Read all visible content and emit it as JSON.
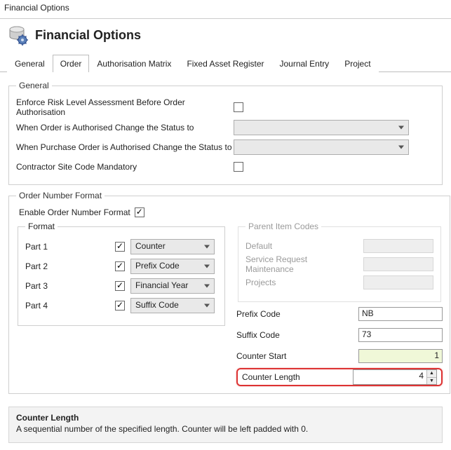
{
  "window": {
    "title": "Financial Options"
  },
  "header": {
    "title": "Financial Options"
  },
  "tabs": {
    "items": [
      {
        "label": "General"
      },
      {
        "label": "Order"
      },
      {
        "label": "Authorisation Matrix"
      },
      {
        "label": "Fixed Asset Register"
      },
      {
        "label": "Journal Entry"
      },
      {
        "label": "Project"
      }
    ],
    "active_index": 1
  },
  "general_group": {
    "legend": "General",
    "enforce_label": "Enforce Risk Level Assessment Before Order Authorisation",
    "auth_status_label": "When Order is Authorised Change the Status to",
    "po_auth_status_label": "When Purchase Order is Authorised Change the Status to",
    "contractor_label": "Contractor Site Code Mandatory"
  },
  "order_number_format": {
    "legend": "Order Number Format",
    "enable_label": "Enable Order Number Format",
    "enable_checked": true,
    "format_legend": "Format",
    "parts": [
      {
        "label": "Part 1",
        "checked": true,
        "value": "Counter"
      },
      {
        "label": "Part 2",
        "checked": true,
        "value": "Prefix Code"
      },
      {
        "label": "Part 3",
        "checked": true,
        "value": "Financial Year"
      },
      {
        "label": "Part 4",
        "checked": true,
        "value": "Suffix Code"
      }
    ],
    "parent_legend": "Parent Item Codes",
    "parent_rows": [
      {
        "label": "Default"
      },
      {
        "label": "Service Request Maintenance"
      },
      {
        "label": "Projects"
      }
    ],
    "prefix_label": "Prefix Code",
    "prefix_value": "NB",
    "suffix_label": "Suffix Code",
    "suffix_value": "73",
    "counter_start_label": "Counter Start",
    "counter_start_value": "1",
    "counter_length_label": "Counter Length",
    "counter_length_value": "4"
  },
  "help": {
    "title": "Counter Length",
    "description": "A sequential number of the specified length. Counter will be left padded with 0."
  }
}
